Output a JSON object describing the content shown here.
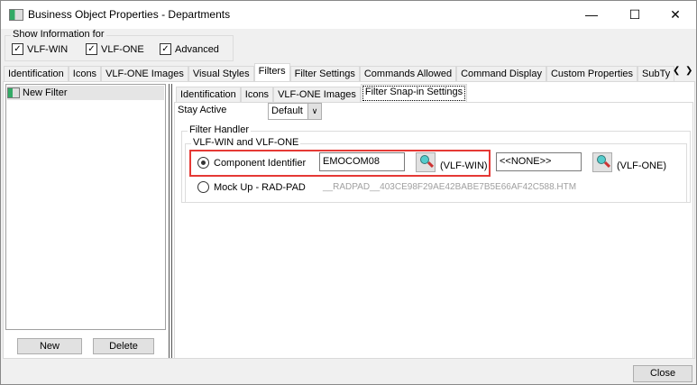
{
  "window": {
    "title": "Business Object Properties - Departments"
  },
  "show_info": {
    "label": "Show Information for",
    "options": [
      {
        "label": "VLF-WIN",
        "checked": true
      },
      {
        "label": "VLF-ONE",
        "checked": true
      },
      {
        "label": "Advanced",
        "checked": true
      }
    ]
  },
  "main_tabs": [
    "Identification",
    "Icons",
    "VLF-ONE Images",
    "Visual Styles",
    "Filters",
    "Filter Settings",
    "Commands Allowed",
    "Command Display",
    "Custom Properties",
    "SubTy"
  ],
  "active_main_tab": "Filters",
  "filters_list": [
    {
      "label": "New Filter"
    }
  ],
  "left_buttons": {
    "new": "New",
    "delete": "Delete"
  },
  "sub_tabs": [
    "Identification",
    "Icons",
    "VLF-ONE Images",
    "Filter Snap-in Settings"
  ],
  "active_sub_tab": "Filter Snap-in Settings",
  "stay_active": {
    "label": "Stay Active",
    "value": "Default"
  },
  "filter_handler": {
    "label": "Filter Handler",
    "subgroup": "VLF-WIN and VLF-ONE",
    "component": {
      "label": "Component Identifier",
      "selected": true,
      "win_value": "EMOCOM08",
      "win_tag": "(VLF-WIN)",
      "one_value": "<<NONE>>",
      "one_tag": "(VLF-ONE)"
    },
    "mockup": {
      "label": "Mock Up - RAD-PAD",
      "selected": false,
      "value": "__RADPAD__403CE98F29AE42BABE7B5E66AF42C588.HTM"
    }
  },
  "highlight_color": "#e53935",
  "close_label": "Close"
}
